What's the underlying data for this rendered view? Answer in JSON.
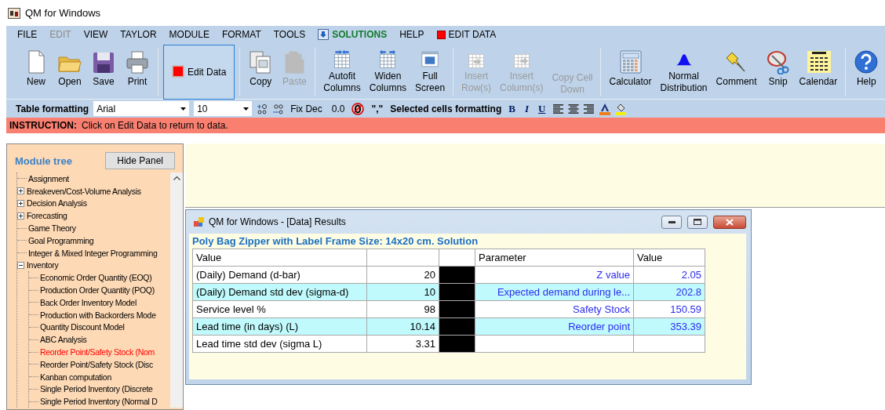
{
  "window": {
    "title": "QM for Windows"
  },
  "menu": [
    {
      "label": "FILE",
      "disabled": false
    },
    {
      "label": "EDIT",
      "disabled": true
    },
    {
      "label": "VIEW",
      "disabled": false
    },
    {
      "label": "TAYLOR",
      "disabled": false
    },
    {
      "label": "MODULE",
      "disabled": false
    },
    {
      "label": "FORMAT",
      "disabled": false
    },
    {
      "label": "TOOLS",
      "disabled": false
    },
    {
      "label": "SOLUTIONS",
      "disabled": false,
      "kind": "solutions"
    },
    {
      "label": "HELP",
      "disabled": false
    },
    {
      "label": "EDIT DATA",
      "disabled": false,
      "kind": "editdata"
    }
  ],
  "toolbar": [
    [
      {
        "label": "New",
        "disabled": false
      },
      {
        "label": "Open",
        "disabled": false
      },
      {
        "label": "Save",
        "disabled": false
      },
      {
        "label": "Print",
        "disabled": false
      }
    ],
    [
      {
        "label": "Edit Data",
        "kind": "toggle",
        "selected": true
      }
    ],
    [
      {
        "label": "Copy",
        "disabled": false
      },
      {
        "label": "Paste",
        "disabled": true
      }
    ],
    [
      {
        "label": "Autofit\nColumns",
        "disabled": false
      },
      {
        "label": "Widen\nColumns",
        "disabled": false
      },
      {
        "label": "Full\nScreen",
        "disabled": false
      }
    ],
    [
      {
        "label": "Insert\nRow(s)",
        "disabled": true
      },
      {
        "label": "Insert\nColumn(s)",
        "disabled": true
      },
      {
        "label": "Copy Cell\nDown",
        "disabled": true
      }
    ],
    [
      {
        "label": "Calculator",
        "disabled": false
      },
      {
        "label": "Normal\nDistribution",
        "disabled": false
      },
      {
        "label": "Comment",
        "disabled": false
      },
      {
        "label": "Snip",
        "disabled": false
      },
      {
        "label": "Calendar",
        "disabled": false
      }
    ],
    [
      {
        "label": "Help",
        "disabled": false
      }
    ]
  ],
  "format_bar": {
    "label": "Table formatting",
    "font": "Arial",
    "size": "10",
    "texts": [
      "Fix Dec",
      "0.0",
      "\",\""
    ],
    "cells_label": "Selected cells formatting",
    "styles": [
      "B",
      "I",
      "U"
    ]
  },
  "instruction": {
    "label": "INSTRUCTION:",
    "text": "Click on Edit Data to return to data."
  },
  "module_tree": {
    "title": "Module tree",
    "button": "Hide Panel",
    "items": [
      {
        "label": "Assignment",
        "selected": false
      },
      {
        "label": "Breakeven/Cost-Volume Analysis",
        "selected": false,
        "expanded": false
      },
      {
        "label": "Decision Analysis",
        "selected": false,
        "expanded": false
      },
      {
        "label": "Forecasting",
        "selected": false,
        "expanded": false
      },
      {
        "label": "Game Theory",
        "selected": false
      },
      {
        "label": "Goal Programming",
        "selected": false
      },
      {
        "label": "Integer & Mixed Integer Programming",
        "selected": false
      },
      {
        "label": "Inventory",
        "selected": false,
        "expanded": true,
        "children": [
          {
            "label": "Economic Order Quantity (EOQ)",
            "selected": false
          },
          {
            "label": "Production Order Quantity (POQ)",
            "selected": false
          },
          {
            "label": "Back Order Inventory Model",
            "selected": false
          },
          {
            "label": "Production with Backorders Mode",
            "selected": false
          },
          {
            "label": "Quantity Discount Model",
            "selected": false
          },
          {
            "label": "ABC Analysis",
            "selected": false
          },
          {
            "label": "Reorder Point/Safety Stock (Nom",
            "selected": true
          },
          {
            "label": "Reorder Point/Safety Stock (Disc",
            "selected": false
          },
          {
            "label": "Kanban computation",
            "selected": false
          },
          {
            "label": "Single Period Inventory (Discrete",
            "selected": false
          },
          {
            "label": "Single Period Inventory (Normal D",
            "selected": false
          }
        ]
      }
    ]
  },
  "results_window": {
    "title": "QM for Windows - [Data] Results",
    "heading": "Poly Bag Zipper with Label Frame Size: 14x20 cm. Solution",
    "columns": {
      "input": "Value",
      "parameter": "Parameter",
      "result": "Value"
    },
    "rows": [
      {
        "label": "(Daily) Demand (d-bar)",
        "value": "20",
        "parameter": "Z value",
        "result": "2.05",
        "highlighted": false
      },
      {
        "label": "(Daily) Demand std dev (sigma-d)",
        "value": "10",
        "parameter": "Expected demand during le...",
        "result": "202.8",
        "highlighted": true
      },
      {
        "label": "Service level %",
        "value": "98",
        "parameter": "Safety Stock",
        "result": "150.59",
        "highlighted": false
      },
      {
        "label": "Lead time (in days) (L)",
        "value": "10.14",
        "parameter": "Reorder point",
        "result": "353.39",
        "highlighted": true
      },
      {
        "label": "Lead time std dev (sigma L)",
        "value": "3.31",
        "highlighted": false
      }
    ]
  }
}
